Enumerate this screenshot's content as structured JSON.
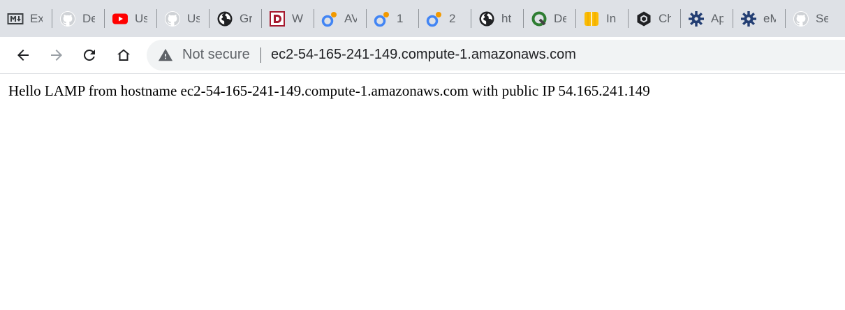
{
  "tabs": [
    {
      "title": "Ex",
      "icon": "markdown-icon"
    },
    {
      "title": "De",
      "icon": "github-icon"
    },
    {
      "title": "Us",
      "icon": "youtube-icon"
    },
    {
      "title": "Us",
      "icon": "github-icon"
    },
    {
      "title": "Gr",
      "icon": "globe-icon"
    },
    {
      "title": "W",
      "icon": "d-logo-icon"
    },
    {
      "title": "AV",
      "icon": "notebook-icon"
    },
    {
      "title": "1",
      "icon": "notebook-icon"
    },
    {
      "title": "2",
      "icon": "notebook-icon"
    },
    {
      "title": "ht",
      "icon": "globe-icon"
    },
    {
      "title": "De",
      "icon": "quire-icon"
    },
    {
      "title": "In",
      "icon": "box-icon"
    },
    {
      "title": "Ch",
      "icon": "hexagon-icon"
    },
    {
      "title": "Ap",
      "icon": "gear-icon"
    },
    {
      "title": "eM",
      "icon": "gear-icon"
    },
    {
      "title": "Se",
      "icon": "github-icon"
    }
  ],
  "address_bar": {
    "security_label": "Not secure",
    "url": "ec2-54-165-241-149.compute-1.amazonaws.com"
  },
  "page": {
    "text": "Hello LAMP from hostname ec2-54-165-241-149.compute-1.amazonaws.com with public IP 54.165.241.149"
  },
  "colors": {
    "tabstrip_bg": "#dee1e6",
    "omnibox_bg": "#f1f3f4",
    "youtube_red": "#ff0000",
    "d_logo": "#a6192e",
    "notebook_blue": "#4285f4",
    "notebook_orange": "#f29900"
  }
}
